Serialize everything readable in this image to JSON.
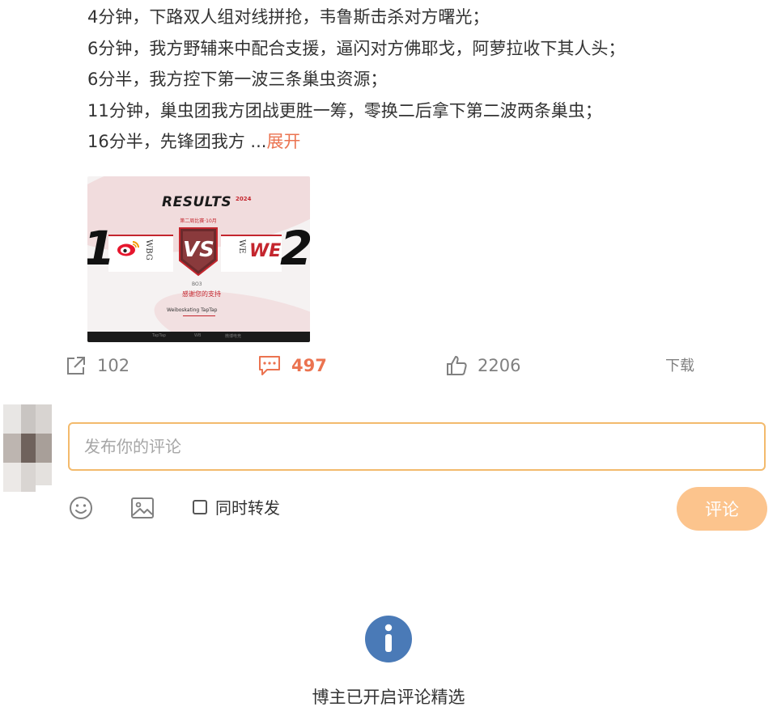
{
  "post": {
    "lines": [
      "4分钟，下路双人组对线拼抢，韦鲁斯击杀对方曙光；",
      "6分钟，我方野辅来中配合支援，逼闪对方佛耶戈，阿萝拉收下其人头；",
      "6分半，我方控下第一波三条巢虫资源；",
      "11分钟，巢虫团我方团战更胜一筹，零换二后拿下第二波两条巢虫；"
    ],
    "last_line_text": "16分半，先锋团我方 ...",
    "expand_label": "展开"
  },
  "result_image": {
    "title": "RESULTS",
    "title_tag": "2024",
    "subtitle": "第二周比赛·10月",
    "left_score": "1",
    "right_score": "2",
    "left_team": "WBG",
    "right_team": "WE",
    "right_logo": "WE",
    "vs": "VS",
    "bo": "BO3",
    "caption": "感谢您的支持",
    "sponsor": "Weiboskating TapTap",
    "bottom_items": [
      "TapTap",
      "WB",
      "微博电竞"
    ],
    "accent_color": "#c4262e"
  },
  "actions": {
    "share_count": "102",
    "comment_count": "497",
    "like_count": "2206",
    "download_label": "下载",
    "active_color": "#eb7350"
  },
  "comment_box": {
    "placeholder": "发布你的评论",
    "repost_label": "同时转发",
    "submit_label": "评论",
    "border_color": "#f3ba6c",
    "button_color": "#fcc48d"
  },
  "footer": {
    "notice": "博主已开启评论精选",
    "icon": "info-icon",
    "icon_color": "#4a7ab7"
  }
}
